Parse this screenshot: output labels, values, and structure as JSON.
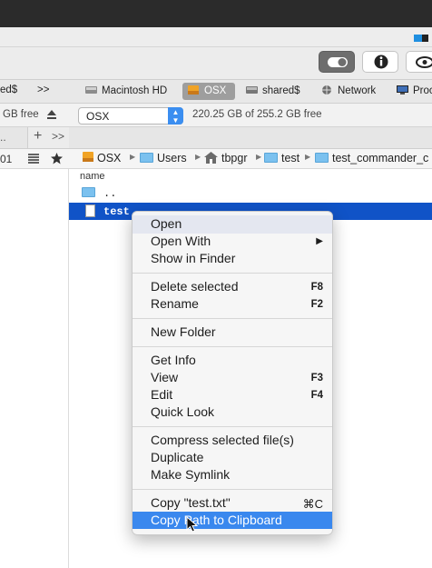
{
  "toolbar": {
    "toggle_icon": "toggle-switch-icon",
    "info_icon": "info-icon",
    "eye_icon": "eye-icon"
  },
  "volumes": {
    "items": [
      {
        "label": "ed$",
        "icon": "network-share-icon"
      },
      {
        "label": ">>",
        "icon": "overflow-chevron-icon"
      },
      {
        "label": "Macintosh HD",
        "icon": "hard-disk-icon"
      },
      {
        "label": "OSX",
        "icon": "external-disk-icon",
        "selected": true
      },
      {
        "label": "shared$",
        "icon": "network-drive-icon"
      },
      {
        "label": "Network",
        "icon": "network-globe-icon"
      },
      {
        "label": "Proc",
        "icon": "monitor-icon"
      }
    ]
  },
  "pathbar": {
    "left_free": "GB free",
    "drive": "OSX",
    "right_free": "220.25 GB of 255.2 GB free"
  },
  "tabs": {
    "left_stub": "..",
    "add": "+",
    "more": ">>"
  },
  "left_crumb": "01",
  "breadcrumb": [
    "OSX",
    "Users",
    "tbpgr",
    "test",
    "test_commander_c"
  ],
  "list": {
    "column_name": "name",
    "rows": [
      {
        "name": "..",
        "type": "folder"
      },
      {
        "name": "test",
        "type": "file",
        "selected": true
      }
    ]
  },
  "context_menu": {
    "groups": [
      [
        {
          "label": "Open"
        },
        {
          "label": "Open With",
          "submenu": "▶"
        },
        {
          "label": "Show in Finder"
        }
      ],
      [
        {
          "label": "Delete selected",
          "shortcut": "F8"
        },
        {
          "label": "Rename",
          "shortcut": "F2"
        }
      ],
      [
        {
          "label": "New Folder"
        }
      ],
      [
        {
          "label": "Get Info"
        },
        {
          "label": "View",
          "shortcut": "F3"
        },
        {
          "label": "Edit",
          "shortcut": "F4"
        },
        {
          "label": "Quick Look"
        }
      ],
      [
        {
          "label": "Compress selected file(s)"
        },
        {
          "label": "Duplicate"
        },
        {
          "label": "Make Symlink"
        }
      ],
      [
        {
          "label": "Copy \"test.txt\"",
          "shortcut": "⌘C"
        },
        {
          "label": "Copy Path to Clipboard",
          "highlighted": true
        }
      ]
    ]
  },
  "colors": {
    "selection": "#1053c7",
    "menu_highlight": "#3a88ee",
    "folder": "#7bc1ef"
  }
}
